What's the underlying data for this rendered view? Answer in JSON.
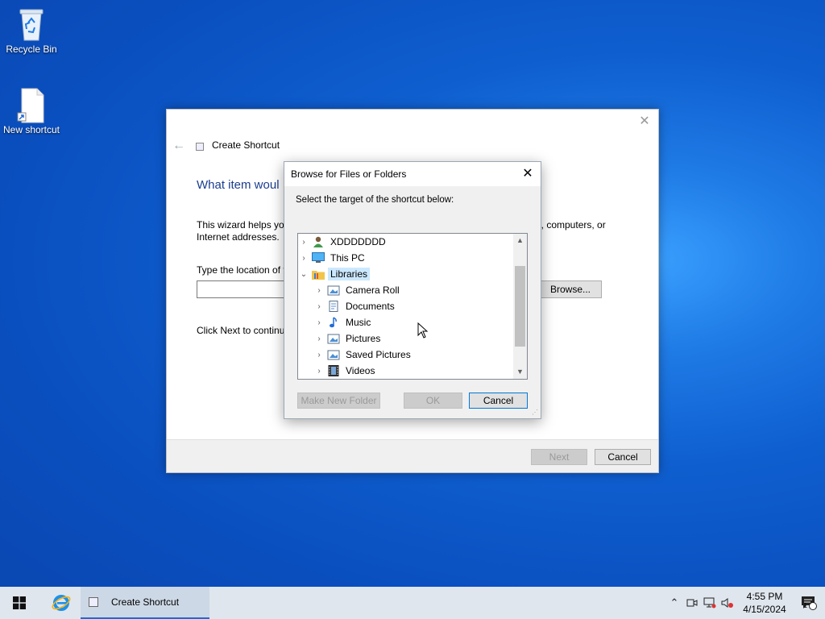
{
  "desktop": {
    "icons": [
      {
        "label": "Recycle Bin"
      },
      {
        "label": "New shortcut"
      }
    ]
  },
  "wizard": {
    "title": "Create Shortcut",
    "heading": "What item woul",
    "description": "This wizard helps you",
    "description_tail": "ers, computers, or",
    "description_line2": "Internet addresses.",
    "location_label": "Type the location of t",
    "location_value": "",
    "browse_label": "Browse...",
    "next_instruction": "Click Next to continu",
    "next_label": "Next",
    "cancel_label": "Cancel"
  },
  "dialog": {
    "title": "Browse for Files or Folders",
    "prompt": "Select the target of the shortcut below:",
    "tree": [
      {
        "label": "XDDDDDDD",
        "icon": "user-icon",
        "level": 0,
        "expanded": false,
        "selected": false
      },
      {
        "label": "This PC",
        "icon": "computer-icon",
        "level": 0,
        "expanded": false,
        "selected": false
      },
      {
        "label": "Libraries",
        "icon": "libraries-icon",
        "level": 0,
        "expanded": true,
        "selected": true
      },
      {
        "label": "Camera Roll",
        "icon": "picture-library-icon",
        "level": 1,
        "expanded": false,
        "selected": false
      },
      {
        "label": "Documents",
        "icon": "documents-icon",
        "level": 1,
        "expanded": false,
        "selected": false
      },
      {
        "label": "Music",
        "icon": "music-icon",
        "level": 1,
        "expanded": false,
        "selected": false
      },
      {
        "label": "Pictures",
        "icon": "picture-library-icon",
        "level": 1,
        "expanded": false,
        "selected": false
      },
      {
        "label": "Saved Pictures",
        "icon": "picture-library-icon",
        "level": 1,
        "expanded": false,
        "selected": false
      },
      {
        "label": "Videos",
        "icon": "videos-icon",
        "level": 1,
        "expanded": false,
        "selected": false
      }
    ],
    "new_folder_label": "Make New Folder",
    "ok_label": "OK",
    "cancel_label": "Cancel"
  },
  "taskbar": {
    "task_label": "Create Shortcut",
    "time": "4:55 PM",
    "date": "4/15/2024",
    "notification_count": "1"
  },
  "colors": {
    "accent": "#0078d7",
    "selection": "#cce8ff",
    "heading": "#1b3d8f"
  }
}
